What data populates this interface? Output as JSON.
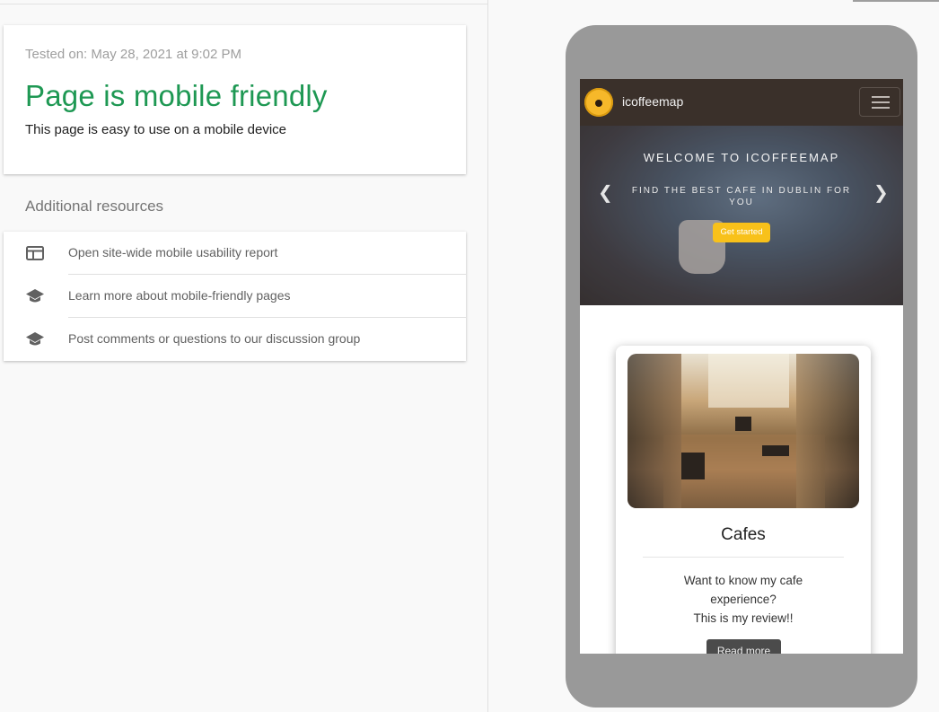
{
  "result": {
    "tested_on": "Tested on: May 28, 2021 at 9:02 PM",
    "verdict": "Page is mobile friendly",
    "description": "This page is easy to use on a mobile device",
    "verdict_color": "#1e9853"
  },
  "resources": {
    "heading": "Additional resources",
    "items": [
      {
        "icon": "web-layout-icon",
        "label": "Open site-wide mobile usability report"
      },
      {
        "icon": "school-icon",
        "label": "Learn more about mobile-friendly pages"
      },
      {
        "icon": "school-icon",
        "label": "Post comments or questions to our discussion group"
      }
    ]
  },
  "preview": {
    "brand": "icoffeemap",
    "hero_title": "WELCOME TO ICOFFEEMAP",
    "hero_subtitle": "FIND THE BEST CAFE IN DUBLIN FOR YOU",
    "hero_button": "Get started",
    "prev_icon": "chevron-left-icon",
    "next_icon": "chevron-right-icon",
    "card": {
      "title": "Cafes",
      "text_line1": "Want to know my cafe",
      "text_line2": "experience?",
      "text_line3": "This is my review!!",
      "button": "Read more"
    }
  }
}
